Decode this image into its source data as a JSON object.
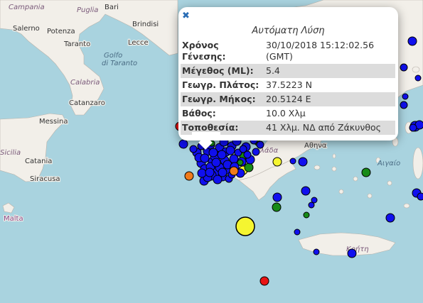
{
  "map": {
    "place_labels": {
      "campania": "Campania",
      "puglia": "Puglia",
      "bari": "Bari",
      "salerno": "Salerno",
      "potenza": "Potenza",
      "brindisi": "Brindisi",
      "lecce": "Lecce",
      "taranto": "Taranto",
      "golfo": "Golfo",
      "di_taranto": "di Taranto",
      "calabria": "Calabria",
      "catanzaro": "Catanzaro",
      "messina": "Messina",
      "sicilia": "Sicilia",
      "catania": "Catania",
      "siracusa": "Siracusa",
      "malta": "Malta",
      "athina": "Αθηνα",
      "aigaio": "Αιγαίο",
      "kriti": "Κρήτη",
      "ellada": "λάδα"
    },
    "marker_colors": {
      "blue": "#1010ee",
      "green": "#178a17",
      "yellow": "#f5f530",
      "orange": "#f07a1a",
      "red": "#e81414"
    }
  },
  "popup": {
    "close_symbol": "✖",
    "title": "Αυτόματη Λύση",
    "rows": [
      {
        "label": "Χρόνος Γένεσης:",
        "value": "30/10/2018 15:12:02.56 (GMT)"
      },
      {
        "label": "Μέγεθος (ML):",
        "value": "5.4"
      },
      {
        "label": "Γεωγρ. Πλάτος:",
        "value": "37.5223 N"
      },
      {
        "label": "Γεωγρ. Μήκος:",
        "value": "20.5124 E"
      },
      {
        "label": "Βάθος:",
        "value": "10.0 Χλμ"
      },
      {
        "label": "Τοποθεσία:",
        "value": "41 Χλμ. ΝΔ από Ζάκυνθος"
      }
    ]
  }
}
